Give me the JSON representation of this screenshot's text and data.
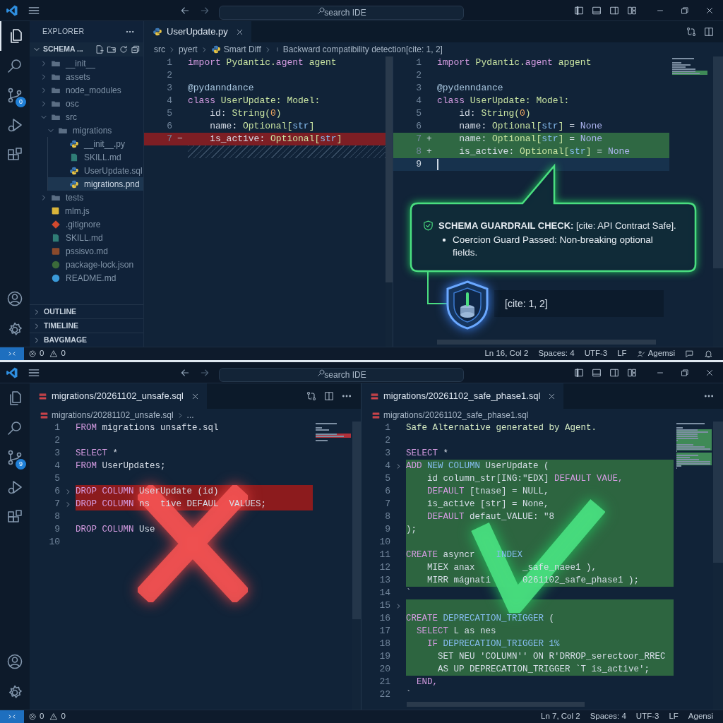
{
  "top_window": {
    "title_bar": {
      "search_placeholder": "search IDE"
    },
    "activity_bar": {
      "explorer_open": true,
      "source_control_badge": "0"
    },
    "explorer": {
      "title": "EXPLORER",
      "root": "SCHEMA ...",
      "tree": [
        {
          "label": "__init__",
          "kind": "folder",
          "expanded": false,
          "selected": false
        },
        {
          "label": "assets",
          "kind": "folder",
          "expanded": false,
          "selected": false
        },
        {
          "label": "node_modules",
          "kind": "folder",
          "expanded": false,
          "selected": false
        },
        {
          "label": "osc",
          "kind": "folder",
          "expanded": false,
          "selected": false
        },
        {
          "label": "src",
          "kind": "folder",
          "expanded": true,
          "selected": false,
          "children": [
            {
              "label": "migrations",
              "kind": "folder",
              "expanded": true,
              "selected": false,
              "children": [
                {
                  "label": "__init__.py",
                  "kind": "python",
                  "selected": false
                },
                {
                  "label": "SKILL.md",
                  "kind": "markdown",
                  "selected": false
                },
                {
                  "label": "UserUpdate.sql",
                  "kind": "python",
                  "selected": false
                },
                {
                  "label": "migrations.pnd",
                  "kind": "python",
                  "selected": true
                }
              ]
            }
          ]
        },
        {
          "label": "tests",
          "kind": "folder",
          "expanded": false,
          "selected": false
        },
        {
          "label": "mlm.js",
          "kind": "js",
          "selected": false
        },
        {
          "label": ".gitignore",
          "kind": "git",
          "selected": false
        },
        {
          "label": "SKILL.md",
          "kind": "markdown",
          "selected": false
        },
        {
          "label": "pssisvo.md",
          "kind": "text",
          "selected": false
        },
        {
          "label": "package-lock.json",
          "kind": "json",
          "selected": false
        },
        {
          "label": "README.md",
          "kind": "info",
          "selected": false
        }
      ],
      "sections": [
        {
          "label": "OUTLINE"
        },
        {
          "label": "TIMELINE"
        },
        {
          "label": "BAVGMAGE"
        }
      ]
    },
    "editor": {
      "tab": {
        "label": "UserUpdate.py",
        "kind": "python"
      },
      "actions": [
        {
          "kind": "compare"
        },
        {
          "kind": "split"
        }
      ],
      "breadcrumbs": [
        {
          "label": "src",
          "kind": "plain"
        },
        {
          "label": "pyert",
          "kind": "plain"
        },
        {
          "label": "Smart Diff",
          "kind": "python"
        },
        {
          "label": "Backward compatibility detection[cite: 1, 2]",
          "kind": "bar"
        }
      ],
      "left_lines": [
        {
          "n": "1",
          "kind": "plain",
          "code": [
            {
              "text": "import",
              "kind": "keyword"
            },
            {
              "text": " Pydantic.",
              "kind": "name"
            },
            {
              "text": "agent",
              "kind": "keyword"
            },
            {
              "text": " agent",
              "kind": "name"
            }
          ]
        },
        {
          "n": "2",
          "kind": "plain"
        },
        {
          "n": "3",
          "kind": "plain",
          "code": [
            {
              "text": "@pydanndance",
              "kind": "decorator"
            }
          ]
        },
        {
          "n": "4",
          "kind": "plain",
          "code": [
            {
              "text": "class",
              "kind": "keyword"
            },
            {
              "text": " UserUpdate: Model:",
              "kind": "name"
            }
          ]
        },
        {
          "n": "5",
          "kind": "plain",
          "code": [
            {
              "text": "    id: ",
              "kind": "plain"
            },
            {
              "text": "String(",
              "kind": "name"
            },
            {
              "text": "0",
              "kind": "number"
            },
            {
              "text": ")",
              "kind": "name"
            }
          ]
        },
        {
          "n": "6",
          "kind": "plain",
          "code": [
            {
              "text": "    name: ",
              "kind": "plain"
            },
            {
              "text": "Optional[",
              "kind": "name"
            },
            {
              "text": "str",
              "kind": "type"
            },
            {
              "text": "]",
              "kind": "name"
            }
          ]
        },
        {
          "n": "7",
          "kind": "removed",
          "sign": "−",
          "code": [
            {
              "text": "    is_active: ",
              "kind": "plain"
            },
            {
              "text": "Optional[",
              "kind": "name"
            },
            {
              "text": "str",
              "kind": "type"
            },
            {
              "text": "]",
              "kind": "name"
            }
          ]
        }
      ],
      "right_lines": [
        {
          "n": "1",
          "kind": "plain",
          "code": [
            {
              "text": "import",
              "kind": "keyword"
            },
            {
              "text": " Pydantic.",
              "kind": "name"
            },
            {
              "text": "agent",
              "kind": "keyword"
            },
            {
              "text": " apgent",
              "kind": "name"
            }
          ]
        },
        {
          "n": "2",
          "kind": "plain"
        },
        {
          "n": "3",
          "kind": "plain",
          "code": [
            {
              "text": "@pydenndance",
              "kind": "decorator"
            }
          ]
        },
        {
          "n": "4",
          "kind": "plain",
          "code": [
            {
              "text": "class",
              "kind": "keyword"
            },
            {
              "text": " UserUpdate: Model:",
              "kind": "name"
            }
          ]
        },
        {
          "n": "5",
          "kind": "plain",
          "code": [
            {
              "text": "    id: ",
              "kind": "plain"
            },
            {
              "text": "String(",
              "kind": "name"
            },
            {
              "text": "0",
              "kind": "number"
            },
            {
              "text": ")",
              "kind": "name"
            }
          ]
        },
        {
          "n": "6",
          "kind": "plain",
          "code": [
            {
              "text": "    name: ",
              "kind": "plain"
            },
            {
              "text": "Optional[",
              "kind": "name"
            },
            {
              "text": "str",
              "kind": "type"
            },
            {
              "text": "]",
              "kind": "name"
            },
            {
              "text": " = ",
              "kind": "plain"
            },
            {
              "text": "None",
              "kind": "constant"
            }
          ]
        },
        {
          "n": "7",
          "kind": "added",
          "sign": "+",
          "code": [
            {
              "text": "    name: ",
              "kind": "plain"
            },
            {
              "text": "Optional[",
              "kind": "name"
            },
            {
              "text": "str",
              "kind": "type"
            },
            {
              "text": "]",
              "kind": "name"
            },
            {
              "text": " = ",
              "kind": "plain"
            },
            {
              "text": "None",
              "kind": "constant"
            }
          ]
        },
        {
          "n": "8",
          "kind": "added",
          "sign": "+",
          "code": [
            {
              "text": "    is_active: ",
              "kind": "plain"
            },
            {
              "text": "Optional[",
              "kind": "name"
            },
            {
              "text": "str",
              "kind": "type"
            },
            {
              "text": "]",
              "kind": "name"
            },
            {
              "text": " = ",
              "kind": "plain"
            },
            {
              "text": "None",
              "kind": "constant"
            }
          ]
        },
        {
          "n": "9",
          "kind": "cursor"
        }
      ]
    },
    "guardrail": {
      "heading": "**SCHEMA GUARDRAIL CHECK:** [cite: API Contract Safe].",
      "bullet": "Coercion Guard Passed: Non-breaking optional fields.",
      "citation": "[cite: 1, 2]"
    },
    "status_bar": {
      "errors": "0",
      "warnings": "0",
      "items": [
        {
          "kind": "text",
          "text": "Ln 16, Col 2"
        },
        {
          "kind": "text",
          "text": "Spaces: 4"
        },
        {
          "kind": "text",
          "text": "UTF-3"
        },
        {
          "kind": "text",
          "text": "LF"
        },
        {
          "kind": "account",
          "text": "Agemsi"
        },
        {
          "kind": "feedback"
        },
        {
          "kind": "bell"
        }
      ]
    }
  },
  "bottom_window": {
    "title_bar": {
      "search_placeholder": "search IDE"
    },
    "activity_bar": {
      "explorer_open": false,
      "source_control_badge": "9"
    },
    "left_editor": {
      "tab": {
        "label": "migrations/20261102_unsafe.sql",
        "kind": "sql"
      },
      "actions": [
        {
          "kind": "compare"
        },
        {
          "kind": "split"
        },
        {
          "kind": "more"
        }
      ],
      "breadcrumbs": [
        {
          "label": "migrations/20281102_unsafe.sql",
          "kind": "sql"
        },
        {
          "label": "...",
          "kind": "plain"
        }
      ],
      "lines": [
        {
          "n": "1",
          "kind": "plain",
          "fold": false,
          "code": [
            {
              "text": "FROM",
              "kind": "keyword"
            },
            {
              "text": " migrations unsafte.sql",
              "kind": "plain"
            }
          ]
        },
        {
          "n": "2",
          "kind": "plain",
          "fold": false
        },
        {
          "n": "3",
          "kind": "plain",
          "fold": false,
          "code": [
            {
              "text": "SELECT",
              "kind": "keyword"
            },
            {
              "text": " *",
              "kind": "plain"
            }
          ]
        },
        {
          "n": "4",
          "kind": "plain",
          "fold": false,
          "code": [
            {
              "text": "FROM",
              "kind": "keyword"
            },
            {
              "text": " UserUpdates;",
              "kind": "plain"
            }
          ]
        },
        {
          "n": "5",
          "kind": "plain",
          "fold": false
        },
        {
          "n": "6",
          "kind": "removed",
          "fold": true,
          "code": [
            {
              "text": "DROP COLUMN",
              "kind": "keyword"
            },
            {
              "text": " UserUpdate (id)",
              "kind": "plain"
            }
          ]
        },
        {
          "n": "7",
          "kind": "removed",
          "fold": true,
          "code": [
            {
              "text": "DROP COLUMN",
              "kind": "keyword"
            },
            {
              "text": " ns  tive DEFAUL  VALUES;",
              "kind": "plain"
            }
          ]
        },
        {
          "n": "8",
          "kind": "plain",
          "fold": false
        },
        {
          "n": "9",
          "kind": "plain",
          "fold": false,
          "code": [
            {
              "text": "DROP COLUMN",
              "kind": "keyword"
            },
            {
              "text": " Use",
              "kind": "plain"
            }
          ]
        },
        {
          "n": "10",
          "kind": "plain",
          "fold": false
        }
      ]
    },
    "right_editor": {
      "tab": {
        "label": "migrations/20261102_safe_phase1.sql",
        "kind": "sql"
      },
      "actions": [
        {
          "kind": "more"
        }
      ],
      "breadcrumbs": [
        {
          "label": "migrations/20261102_safe_phase1.sql",
          "kind": "sql"
        }
      ],
      "lines": [
        {
          "n": "1",
          "kind": "plain",
          "fold": false,
          "code": [
            {
              "text": "Safe Alternative generated by Agent.",
              "kind": "comment"
            }
          ]
        },
        {
          "n": "2",
          "kind": "plain",
          "fold": false
        },
        {
          "n": "3",
          "kind": "plain",
          "fold": false,
          "code": [
            {
              "text": "SELECT",
              "kind": "keyword"
            },
            {
              "text": " *",
              "kind": "plain"
            }
          ]
        },
        {
          "n": "4",
          "kind": "added",
          "fold": true,
          "code": [
            {
              "text": "ADD",
              "kind": "keyword"
            },
            {
              "text": " NEW COLUMN",
              "kind": "type"
            },
            {
              "text": " UserUpdate (",
              "kind": "plain"
            }
          ]
        },
        {
          "n": "5",
          "kind": "added",
          "fold": false,
          "code": [
            {
              "text": "    id column_str[ING:\"EDX] ",
              "kind": "plain"
            },
            {
              "text": "DEFAULT VAUE,",
              "kind": "keyword"
            }
          ]
        },
        {
          "n": "6",
          "kind": "added",
          "fold": false,
          "code": [
            {
              "text": "    DEFAULT",
              "kind": "keyword"
            },
            {
              "text": " [tnase] = NULL,",
              "kind": "plain"
            }
          ]
        },
        {
          "n": "7",
          "kind": "added",
          "fold": false,
          "code": [
            {
              "text": "    is_active [str] = None,",
              "kind": "plain"
            }
          ]
        },
        {
          "n": "8",
          "kind": "added",
          "fold": false,
          "code": [
            {
              "text": "    DEFAULT",
              "kind": "keyword"
            },
            {
              "text": " defaut_VALUE: \"8",
              "kind": "plain"
            }
          ]
        },
        {
          "n": "9",
          "kind": "added",
          "fold": false,
          "code": [
            {
              "text": ");",
              "kind": "plain"
            }
          ]
        },
        {
          "n": "10",
          "kind": "added",
          "fold": false
        },
        {
          "n": "11",
          "kind": "added",
          "fold": false,
          "code": [
            {
              "text": "CREATE",
              "kind": "keyword"
            },
            {
              "text": " asyncr",
              "kind": "plain"
            },
            {
              "text": "    INDEX",
              "kind": "type"
            }
          ]
        },
        {
          "n": "12",
          "kind": "added",
          "fold": false,
          "code": [
            {
              "text": "    MIEX anax         _safe_naee1 ),",
              "kind": "plain"
            }
          ]
        },
        {
          "n": "13",
          "kind": "added",
          "fold": false,
          "code": [
            {
              "text": "    MIRR mágnati      0261102_safe_phase1 );",
              "kind": "plain"
            }
          ]
        },
        {
          "n": "14",
          "kind": "plain",
          "fold": false,
          "code": [
            {
              "text": "`",
              "kind": "plain"
            }
          ]
        },
        {
          "n": "15",
          "kind": "added",
          "fold": true
        },
        {
          "n": "16",
          "kind": "added",
          "fold": false,
          "code": [
            {
              "text": "CREATE",
              "kind": "keyword"
            },
            {
              "text": " DEPRECATION_TRIGGER",
              "kind": "type"
            },
            {
              "text": " (",
              "kind": "plain"
            }
          ]
        },
        {
          "n": "17",
          "kind": "added",
          "fold": false,
          "code": [
            {
              "text": "  SELECT",
              "kind": "keyword"
            },
            {
              "text": " L as nes",
              "kind": "plain"
            }
          ]
        },
        {
          "n": "18",
          "kind": "added",
          "fold": false,
          "code": [
            {
              "text": "    IF",
              "kind": "keyword"
            },
            {
              "text": " DEPRECATION_TRIGGER 1%",
              "kind": "type"
            }
          ]
        },
        {
          "n": "19",
          "kind": "added",
          "fold": false,
          "code": [
            {
              "text": "      SET NEU 'COLUMN'' ON R'DRROP_serectoor_RREC",
              "kind": "plain"
            }
          ]
        },
        {
          "n": "20",
          "kind": "added",
          "fold": false,
          "code": [
            {
              "text": "      AS UP DEPRECATION_TRIGGER `T is_active';",
              "kind": "plain"
            }
          ]
        },
        {
          "n": "21",
          "kind": "plain",
          "fold": false,
          "code": [
            {
              "text": "  END,",
              "kind": "keyword"
            }
          ]
        },
        {
          "n": "22",
          "kind": "plain",
          "fold": false,
          "code": [
            {
              "text": "`",
              "kind": "plain"
            }
          ]
        }
      ]
    },
    "status_bar": {
      "errors": "0",
      "warnings": "0",
      "items": [
        {
          "kind": "text",
          "text": "Ln 7, Col 2"
        },
        {
          "kind": "text",
          "text": "Spaces: 4"
        },
        {
          "kind": "text",
          "text": "UTF-3"
        },
        {
          "kind": "text",
          "text": "LF"
        },
        {
          "kind": "text",
          "text": "Agensi"
        }
      ]
    }
  }
}
